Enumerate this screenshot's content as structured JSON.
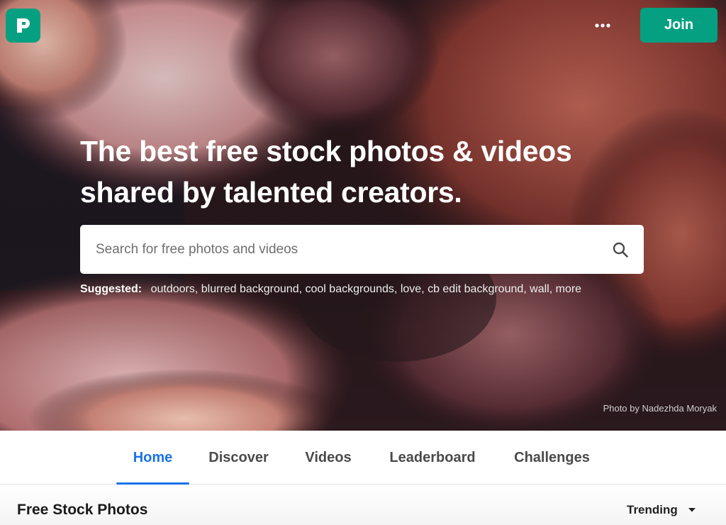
{
  "header": {
    "join_label": "Join",
    "more_icon": "more-horizontal-icon",
    "logo_icon": "pexels-logo"
  },
  "hero": {
    "title_line1": "The best free stock photos & videos",
    "title_line2": "shared by talented creators.",
    "search_placeholder": "Search for free photos and videos",
    "search_value": "",
    "suggested_label": "Suggested:",
    "suggested_items": [
      "outdoors",
      "blurred background",
      "cool backgrounds",
      "love",
      "cb edit background",
      "wall",
      "more"
    ],
    "photo_credit": "Photo by Nadezhda Moryak"
  },
  "nav": {
    "tabs": [
      {
        "label": "Home",
        "active": true
      },
      {
        "label": "Discover",
        "active": false
      },
      {
        "label": "Videos",
        "active": false
      },
      {
        "label": "Leaderboard",
        "active": false
      },
      {
        "label": "Challenges",
        "active": false
      }
    ]
  },
  "section": {
    "title": "Free Stock Photos",
    "sort_value": "Trending"
  },
  "colors": {
    "brand_green": "#05a081",
    "active_tab_blue": "#1a73e8"
  }
}
